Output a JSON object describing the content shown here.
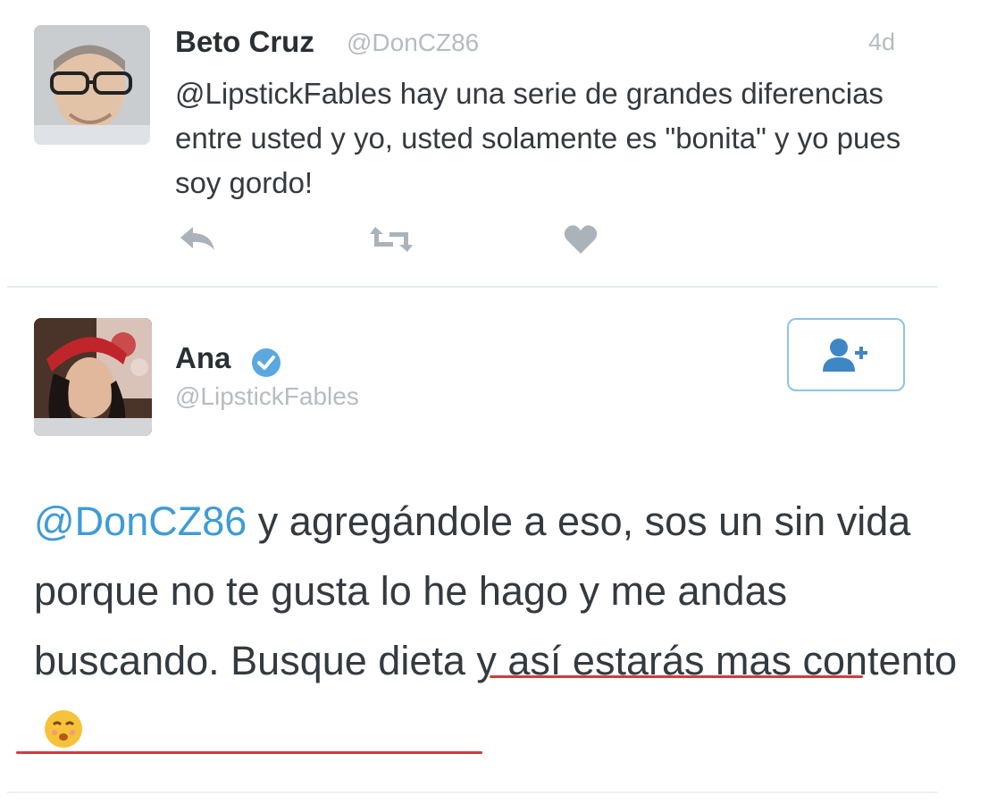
{
  "reply_tweet": {
    "author_name": "Beto Cruz",
    "author_handle": "@DonCZ86",
    "timestamp": "4d",
    "text": "@LipstickFables hay una serie de grandes diferencias entre usted y yo, usted solamente es \"bonita\" y yo pues soy gordo!",
    "actions": [
      "reply-icon",
      "retweet-icon",
      "like-icon"
    ]
  },
  "main_tweet": {
    "author_name": "Ana",
    "author_handle": "@LipstickFables",
    "verified": true,
    "follow_icon": "follow-user-icon",
    "mention": "@DonCZ86",
    "text_plain": " y agregándole a eso, sos un sin vida porque no te gusta lo he hago y me andas buscando. ",
    "text_underlined": "Busque dieta y así estarás mas contento",
    "emoji": "kissing-face-icon"
  },
  "colors": {
    "accent": "#3e9cd6",
    "underline": "#d63a3a",
    "muted": "#b5bcc2"
  }
}
